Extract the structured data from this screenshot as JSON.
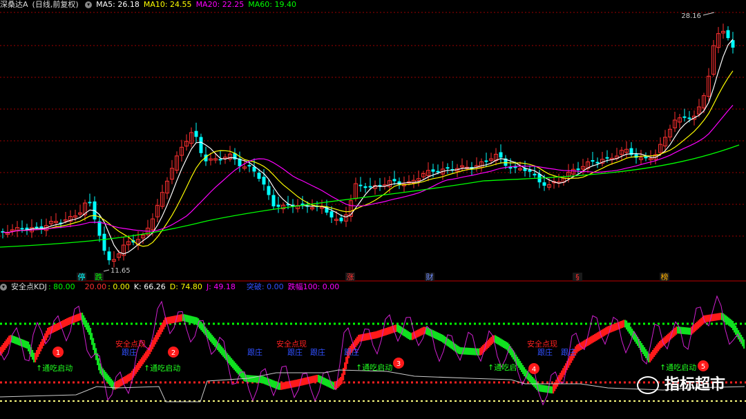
{
  "main_header": {
    "stock_name": "深桑达A",
    "period": "(日线,前复权)",
    "ma5": "MA5: 26.18",
    "ma10": "MA10: 24.55",
    "ma20": "MA20: 22.25",
    "ma60": "MA60: 19.40"
  },
  "colors": {
    "up": "#ff3030",
    "down": "#00ffff",
    "ma5": "#ffffff",
    "ma10": "#ffff00",
    "ma20": "#ff00ff",
    "ma60": "#00ff00",
    "grid": "#a00000"
  },
  "price_labels": {
    "high": "28.16",
    "low": "11.65"
  },
  "event_markers": [
    {
      "text": "停",
      "color": "#00ffff"
    },
    {
      "text": "跌",
      "color": "#00ff00"
    },
    {
      "text": "涨",
      "color": "#ff3030"
    },
    {
      "text": "财",
      "color": "#6f8cff"
    },
    {
      "text": "§",
      "color": "#ff3030"
    },
    {
      "text": "榜",
      "color": "#ffb000"
    }
  ],
  "indicator_header": {
    "name": "安全点KDJ",
    "v80": ": 80.00",
    "v20": "20.00",
    "v0": ": 0.00",
    "k": "K: 66.26",
    "d": "D: 74.80",
    "j": "J: 49.18",
    "breakthrough": "突破: 0.00",
    "drop100": "跌幅100: 0.00"
  },
  "annotations": {
    "start_label": "↑通吃启动",
    "start_label_alt": "↑通吃启",
    "safe_point": "安全点现",
    "follow": "跟庄",
    "numbers": [
      "1",
      "2",
      "3",
      "4",
      "5"
    ]
  },
  "watermark": "指标超市"
}
